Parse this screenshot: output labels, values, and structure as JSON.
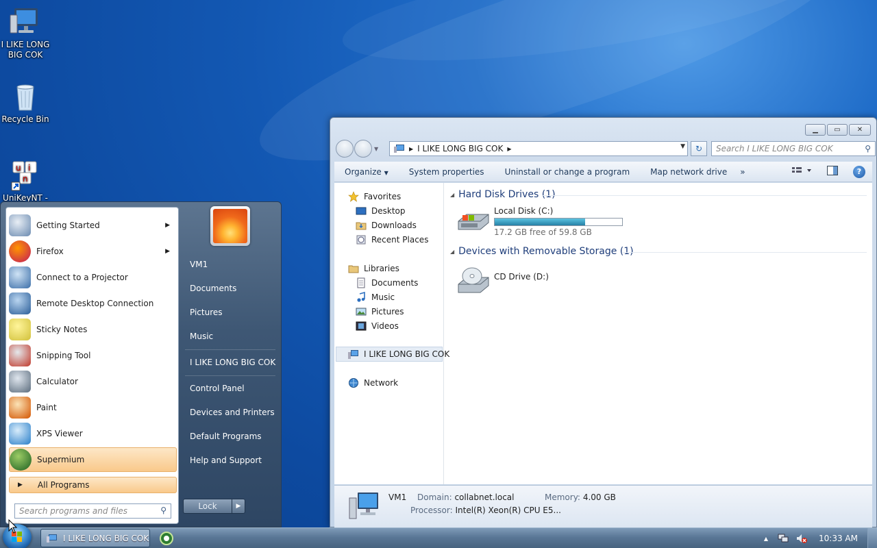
{
  "desktop": {
    "icons": [
      {
        "label": "I LIKE LONG BIG COK",
        "icon": "computer-icon"
      },
      {
        "label": "Recycle Bin",
        "icon": "recycle-bin-icon"
      },
      {
        "label": "UniKeyNT -",
        "icon": "unikey-icon"
      }
    ]
  },
  "explorer": {
    "address": {
      "location": "I LIKE LONG BIG COK"
    },
    "search_placeholder": "Search I LIKE LONG BIG COK",
    "toolbar": {
      "organize": "Organize",
      "system_properties": "System properties",
      "uninstall": "Uninstall or change a program",
      "map_drive": "Map network drive",
      "more": "»",
      "help": "?"
    },
    "nav": {
      "favorites": "Favorites",
      "desktop": "Desktop",
      "downloads": "Downloads",
      "recent": "Recent Places",
      "libraries": "Libraries",
      "documents": "Documents",
      "music": "Music",
      "pictures": "Pictures",
      "videos": "Videos",
      "computer": "I LIKE LONG BIG COK",
      "network": "Network"
    },
    "groups": {
      "hdd": "Hard Disk Drives (1)",
      "removable": "Devices with Removable Storage (1)"
    },
    "drives": {
      "c_name": "Local Disk (C:)",
      "c_free": "17.2 GB free of 59.8 GB",
      "c_used_fraction": 0.712,
      "d_name": "CD Drive (D:)"
    },
    "details": {
      "name": "VM1",
      "domain_label": "Domain:",
      "domain": "collabnet.local",
      "memory_label": "Memory:",
      "memory": "4.00 GB",
      "processor_label": "Processor:",
      "processor": "Intel(R) Xeon(R) CPU E5..."
    }
  },
  "start_menu": {
    "programs": [
      {
        "label": "Getting Started",
        "icon": "getting-started-icon",
        "submenu": true
      },
      {
        "label": "Firefox",
        "icon": "firefox-icon",
        "submenu": true
      },
      {
        "label": "Connect to a Projector",
        "icon": "projector-icon",
        "submenu": false
      },
      {
        "label": "Remote Desktop Connection",
        "icon": "remote-desktop-icon",
        "submenu": false
      },
      {
        "label": "Sticky Notes",
        "icon": "sticky-notes-icon",
        "submenu": false
      },
      {
        "label": "Snipping Tool",
        "icon": "snipping-tool-icon",
        "submenu": false
      },
      {
        "label": "Calculator",
        "icon": "calculator-icon",
        "submenu": false
      },
      {
        "label": "Paint",
        "icon": "paint-icon",
        "submenu": false
      },
      {
        "label": "XPS Viewer",
        "icon": "xps-viewer-icon",
        "submenu": false
      },
      {
        "label": "Supermium",
        "icon": "supermium-icon",
        "submenu": false
      }
    ],
    "all_programs": "All Programs",
    "search_placeholder": "Search programs and files",
    "right": {
      "user": "VM1",
      "documents": "Documents",
      "pictures": "Pictures",
      "music": "Music",
      "computer": "I LIKE LONG BIG COK",
      "control_panel": "Control Panel",
      "devices": "Devices and Printers",
      "default_programs": "Default Programs",
      "help": "Help and Support"
    },
    "lock": "Lock"
  },
  "taskbar": {
    "window_button": "I LIKE LONG BIG COK",
    "clock": "10:33 AM",
    "tray_arrow": "▲"
  },
  "colors": {
    "desktop_blue": "#1358b3",
    "highlight_orange": "#f9c98b",
    "group_header": "#1e3d7a"
  }
}
